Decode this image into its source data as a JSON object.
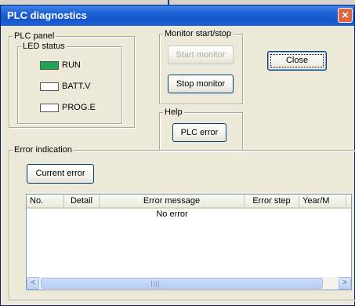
{
  "window": {
    "title": "PLC diagnostics",
    "close_glyph": "×"
  },
  "plc_panel": {
    "legend": "PLC panel",
    "led_status": {
      "legend": "LED status",
      "leds": [
        {
          "label": "RUN",
          "on": true,
          "color": "#22a356"
        },
        {
          "label": "BATT.V",
          "on": false,
          "color": "#ffffff"
        },
        {
          "label": "PROG.E",
          "on": false,
          "color": "#ffffff"
        }
      ]
    }
  },
  "monitor": {
    "legend": "Monitor start/stop",
    "start_label": "Start monitor",
    "stop_label": "Stop monitor"
  },
  "help": {
    "legend": "Help",
    "plc_error_label": "PLC error"
  },
  "close_button": {
    "label": "Close"
  },
  "error_indication": {
    "legend": "Error indication",
    "current_error_label": "Current error",
    "columns": [
      "No.",
      "Detail",
      "Error message",
      "Error step",
      "Year/M"
    ],
    "empty_text": "No error"
  },
  "scrollbar": {
    "left_arrow": "<",
    "right_arrow": ">"
  }
}
